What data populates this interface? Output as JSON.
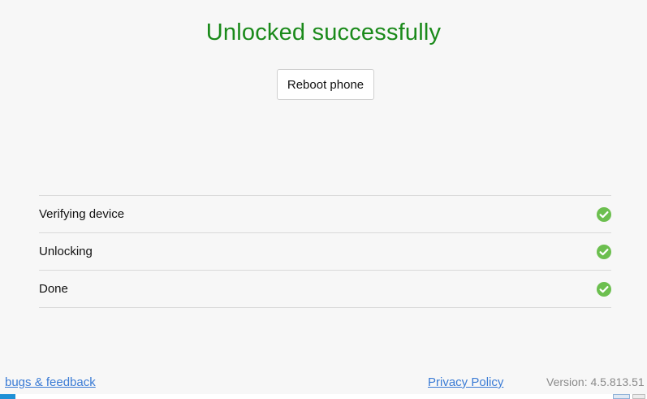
{
  "header": {
    "title": "Unlocked successfully",
    "title_color": "#1a8a1a"
  },
  "actions": {
    "reboot_label": "Reboot phone"
  },
  "steps": {
    "items": [
      {
        "label": "Verifying device",
        "status": "done",
        "icon": "check-circle-icon"
      },
      {
        "label": "Unlocking",
        "status": "done",
        "icon": "check-circle-icon"
      },
      {
        "label": "Done",
        "status": "done",
        "icon": "check-circle-icon"
      }
    ],
    "check_color": "#6cbf4f"
  },
  "footer": {
    "feedback_link": "bugs & feedback",
    "privacy_link": "Privacy Policy",
    "version": "Version: 4.5.813.51",
    "link_color": "#3a7bd5"
  }
}
